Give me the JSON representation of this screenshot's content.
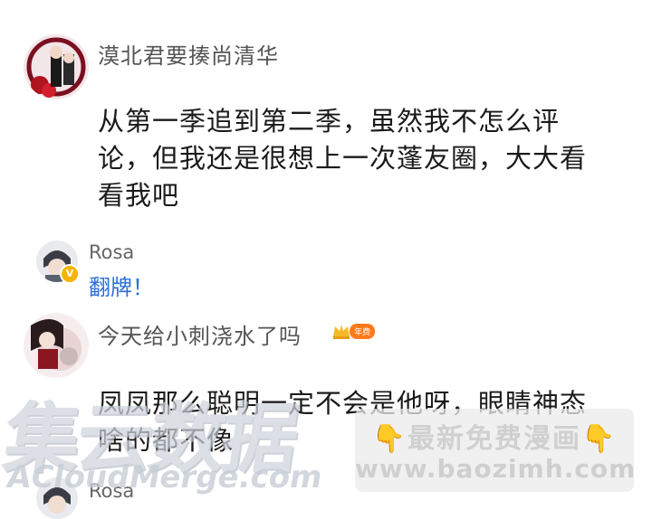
{
  "comments": [
    {
      "user": "漠北君要揍尚清华",
      "lines": [
        "从第一季追到第二季，虽然我不怎么评",
        "论，但我还是很想上一次蓬友圈，大大看",
        "看我吧"
      ],
      "reply": {
        "user": "Rosa",
        "text": "翻牌！"
      }
    },
    {
      "user": "今天给小刺浇水了吗",
      "badge": "年费",
      "lines": [
        "凤凤那么聪明一定不会是他呀，眼睛神态",
        "啥的都不像"
      ],
      "reply": {
        "user": "Rosa"
      }
    }
  ],
  "watermarks": {
    "big": "集云数据",
    "acloud": "ACloudMerge.com",
    "site_line1": "最新免费漫画",
    "site_line2": "www.baozimh.com",
    "hand": "👇"
  },
  "colors": {
    "reply_text": "#2b6fd6",
    "badge_gold": "#f5b400",
    "year_pill": "#ff7a1a"
  }
}
